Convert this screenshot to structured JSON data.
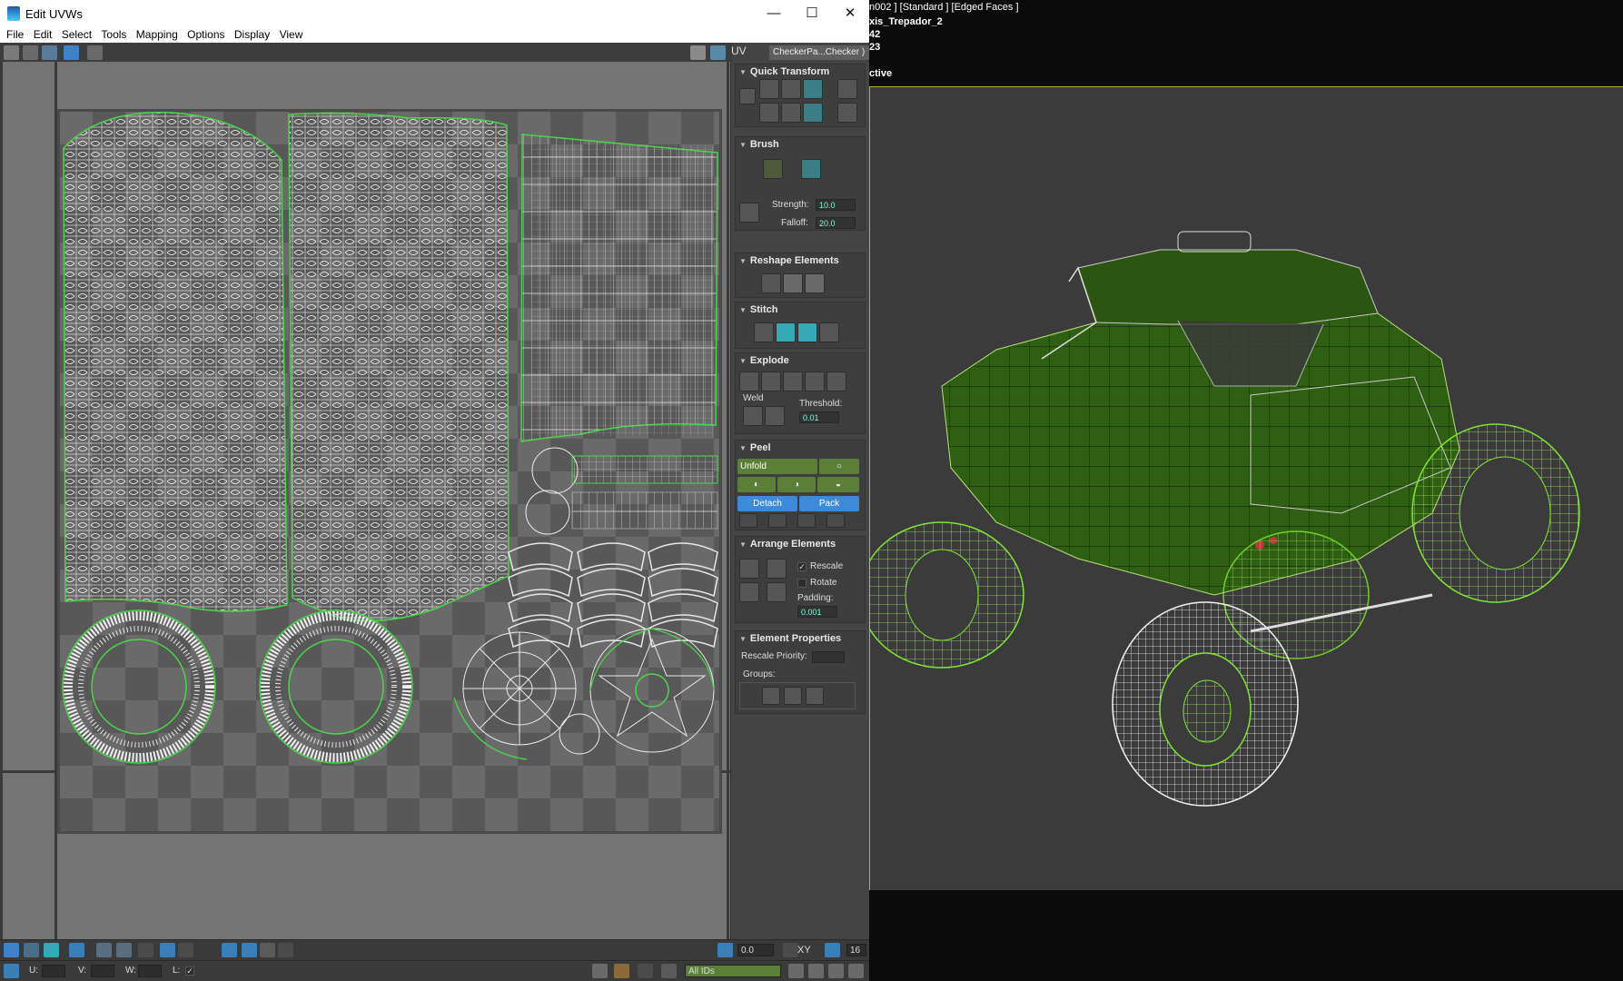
{
  "window": {
    "title": "Edit UVWs",
    "minimize": "—",
    "maximize": "☐",
    "close": "✕"
  },
  "menu": [
    "File",
    "Edit",
    "Select",
    "Tools",
    "Mapping",
    "Options",
    "Display",
    "View"
  ],
  "toolbar": {
    "uv_label": "UV",
    "texture": "CheckerPa...Checker )"
  },
  "rollouts": {
    "quick_transform": "Quick Transform",
    "brush": {
      "title": "Brush",
      "strength_label": "Strength:",
      "strength_value": "10.0",
      "falloff_label": "Falloff:",
      "falloff_value": "20.0"
    },
    "reshape": "Reshape Elements",
    "stitch": "Stitch",
    "explode": {
      "title": "Explode",
      "weld_label": "Weld",
      "threshold_label": "Threshold:",
      "threshold_value": "0.01"
    },
    "peel": {
      "title": "Peel",
      "mode": "Unfold",
      "detach": "Detach",
      "pack": "Pack"
    },
    "arrange": {
      "title": "Arrange Elements",
      "rescale": "Rescale",
      "rotate": "Rotate",
      "padding_label": "Padding:",
      "padding_value": "0.001"
    },
    "element_props": {
      "title": "Element Properties",
      "rescale_priority": "Rescale Priority:",
      "groups": "Groups:"
    }
  },
  "bottom": {
    "u_label": "U:",
    "v_label": "V:",
    "w_label": "W:",
    "l_label": "L:",
    "angle_value": "0.0",
    "xy_label": "XY",
    "grid_value": "16",
    "ids_value": "All IDs"
  },
  "viewport": {
    "header_line": "n002 ] [Standard ] [Edged Faces ]",
    "object_name": "xis_Trepador_2",
    "stat1": "42",
    "stat2": "23",
    "stat3": "ctive"
  },
  "colors": {
    "uv_line": "#e8e8e8",
    "uv_border": "#4cd44c",
    "wire_green": "#7fe633",
    "body_green": "#2f5f12",
    "accent_teal": "#35a9b5",
    "accent_blue": "#3c8ad9",
    "viewport_border": "#b7ad2f"
  }
}
